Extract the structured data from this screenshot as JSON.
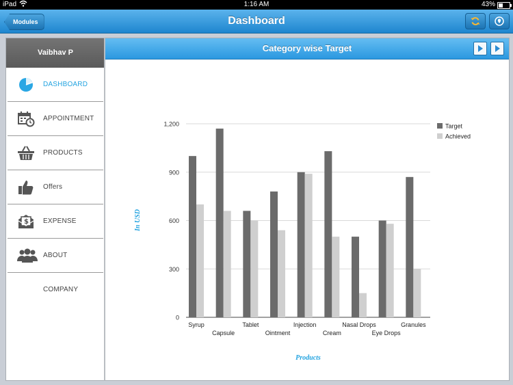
{
  "status": {
    "device": "iPad",
    "time": "1:16 AM",
    "battery": "43%",
    "battery_level": 0.43
  },
  "nav": {
    "back_label": "Modules",
    "title": "Dashboard"
  },
  "sidebar": {
    "user": "Vaibhav P",
    "items": [
      {
        "label": "DASHBOARD",
        "icon": "pie-chart-icon",
        "active": true
      },
      {
        "label": "APPOINTMENT",
        "icon": "calendar-clock-icon",
        "active": false
      },
      {
        "label": "PRODUCTS",
        "icon": "basket-icon",
        "active": false
      },
      {
        "label": "Offers",
        "icon": "thumbs-up-icon",
        "active": false
      },
      {
        "label": "EXPENSE",
        "icon": "money-envelope-icon",
        "active": false
      },
      {
        "label": "ABOUT COMPANY",
        "icon": "people-icon",
        "active": false
      }
    ]
  },
  "panel": {
    "title": "Category wise Target"
  },
  "colors": {
    "accent": "#22a3e0",
    "target": "#6b6b6b",
    "achieved": "#cfcfcf"
  },
  "chart_data": {
    "type": "bar",
    "title": "",
    "xlabel": "Products",
    "ylabel": "In USD",
    "categories": [
      "Syrup",
      "Capsule",
      "Tablet",
      "Ointment",
      "Injection",
      "Cream",
      "Nasal Drops",
      "Eye Drops",
      "Granules"
    ],
    "series": [
      {
        "name": "Target",
        "values": [
          1000,
          1170,
          660,
          780,
          900,
          1030,
          500,
          600,
          870
        ]
      },
      {
        "name": "Achieved",
        "values": [
          700,
          660,
          600,
          540,
          890,
          500,
          150,
          580,
          300
        ]
      }
    ],
    "ylim": [
      0,
      1200
    ],
    "yticks": [
      "0",
      "300",
      "600",
      "900",
      "1,200"
    ],
    "grid": true,
    "legend": "top-right"
  }
}
